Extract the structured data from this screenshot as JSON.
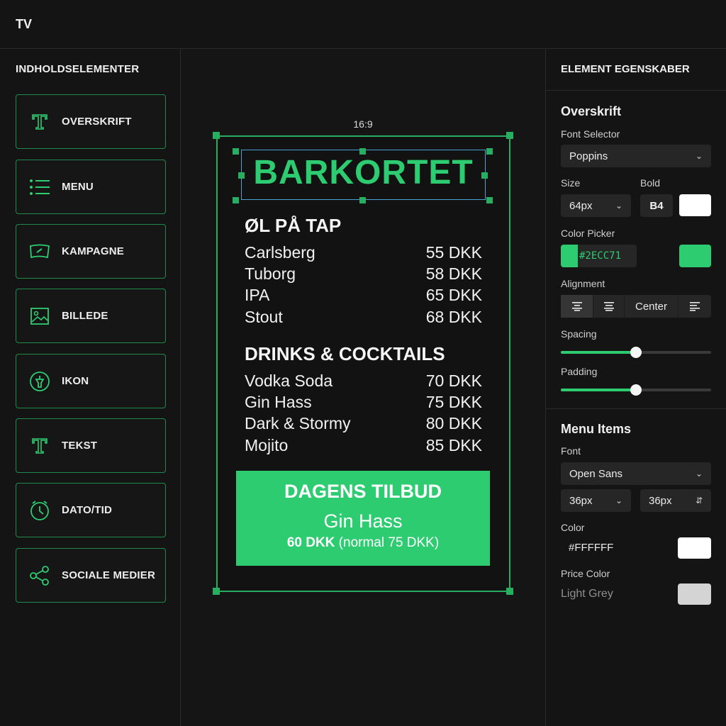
{
  "app": {
    "title": "TV"
  },
  "left": {
    "heading": "INDHOLDSELEMENTER",
    "items": [
      {
        "label": "OVERSKRIFT",
        "icon": "text-t-icon"
      },
      {
        "label": "MENU",
        "icon": "list-icon"
      },
      {
        "label": "KAMPAGNE",
        "icon": "campaign-flag-icon"
      },
      {
        "label": "BILLEDE",
        "icon": "image-icon"
      },
      {
        "label": "IKON",
        "icon": "icon-circle-icon"
      },
      {
        "label": "TEKST",
        "icon": "text-t-icon"
      },
      {
        "label": "DATO/TID",
        "icon": "clock-icon"
      },
      {
        "label": "SOCIALE MEDIER",
        "icon": "share-icon"
      }
    ]
  },
  "canvas": {
    "ratio": "16:9",
    "title": "BARKORTET",
    "sections": [
      {
        "title": "ØL PÅ TAP",
        "rows": [
          {
            "name": "Carlsberg",
            "price": "55 DKK"
          },
          {
            "name": "Tuborg",
            "price": "58 DKK"
          },
          {
            "name": "IPA",
            "price": "65 DKK"
          },
          {
            "name": "Stout",
            "price": "68 DKK"
          }
        ]
      },
      {
        "title": "DRINKS & COCKTAILS",
        "rows": [
          {
            "name": "Vodka Soda",
            "price": "70 DKK"
          },
          {
            "name": "Gin Hass",
            "price": "75 DKK"
          },
          {
            "name": "Dark & Stormy",
            "price": "80 DKK"
          },
          {
            "name": "Mojito",
            "price": "85 DKK"
          }
        ]
      }
    ],
    "offer": {
      "title": "DAGENS TILBUD",
      "item": "Gin Hass",
      "price": "60 DKK",
      "note": "(normal 75 DKK)"
    }
  },
  "right": {
    "heading": "ELEMENT EGENSKABER",
    "overskrift": {
      "section": "Overskrift",
      "font_label": "Font Selector",
      "font_value": "Poppins",
      "size_label": "Size",
      "size_value": "64px",
      "bold_label": "Bold",
      "bold_value": "B4",
      "color_label": "Color Picker",
      "color_hex": "#2ECC71",
      "alignment_label": "Alignment",
      "alignment_center": "Center",
      "spacing_label": "Spacing",
      "spacing_value": 0.5,
      "padding_label": "Padding",
      "padding_value": 0.5
    },
    "menu_items": {
      "section": "Menu Items",
      "font_label": "Font",
      "font_value": "Open Sans",
      "size_a": "36px",
      "size_b": "36px",
      "color_label": "Color",
      "color_value": "#FFFFFF",
      "price_color_label": "Price Color",
      "price_color_value": "Light Grey"
    }
  },
  "colors": {
    "accent": "#2ecc71",
    "selection": "#4aa3d6",
    "white": "#ffffff",
    "light_grey": "#d4d4d4"
  }
}
